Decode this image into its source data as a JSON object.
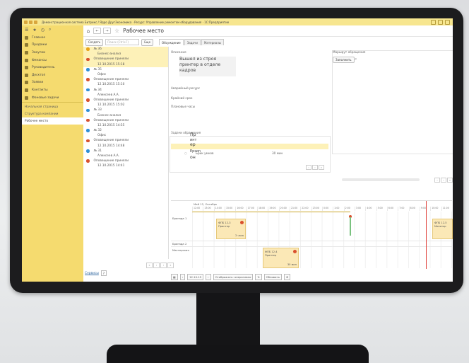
{
  "window": {
    "title": "Демонстрационная система Битрикс / Ядро ДругЭкономика · Ресурс: Управление ремонтом оборудования · 1С:Предприятие"
  },
  "sidebar": {
    "items": [
      {
        "label": "Главное",
        "icon": "home-icon"
      },
      {
        "label": "Продажи",
        "icon": "sales-icon"
      },
      {
        "label": "Закупки",
        "icon": "purchase-icon"
      },
      {
        "label": "Финансы",
        "icon": "finance-icon"
      },
      {
        "label": "Руководитель",
        "icon": "manager-icon"
      },
      {
        "label": "Десктоп",
        "icon": "desktop-icon"
      },
      {
        "label": "Заявки",
        "icon": "request-icon"
      },
      {
        "label": "Контакты",
        "icon": "contacts-icon"
      },
      {
        "label": "Фоновые задачи",
        "icon": "tasks-icon"
      }
    ],
    "links": [
      {
        "label": "Начальная страница",
        "active": false
      },
      {
        "label": "Структура компании",
        "active": false
      },
      {
        "label": "Рабочее место",
        "active": true
      }
    ]
  },
  "header": {
    "page_title": "Рабочее место",
    "back_label": "←",
    "forward_label": "→"
  },
  "controls": {
    "create_label": "Создать",
    "search_placeholder": "Поиск (Ctrl+F)",
    "more_label": "Еще",
    "tabs": [
      {
        "label": "Обсуждение",
        "active": true
      },
      {
        "label": "Задачи",
        "active": false
      },
      {
        "label": "Материалы",
        "active": false
      }
    ]
  },
  "list": {
    "rows": [
      {
        "text": "№ 36",
        "dot": "#e8a31b",
        "sel": true,
        "indent": false
      },
      {
        "text": "Бизнес-анализ",
        "dot": "",
        "sel": true,
        "indent": true
      },
      {
        "text": "Оповещение приняли",
        "dot": "#d9502e",
        "sel": true,
        "indent": false
      },
      {
        "text": "12.10.2015 15:18",
        "dot": "",
        "sel": true,
        "indent": true
      },
      {
        "text": "№ 35",
        "dot": "#2e8fd8",
        "sel": false,
        "indent": false
      },
      {
        "text": "Офис",
        "dot": "",
        "sel": false,
        "indent": true
      },
      {
        "text": "Оповещение приняли",
        "dot": "#d9502e",
        "sel": false,
        "indent": false
      },
      {
        "text": "12.10.2015 15:10",
        "dot": "",
        "sel": false,
        "indent": true
      },
      {
        "text": "№ 34",
        "dot": "#2e8fd8",
        "sel": false,
        "indent": false
      },
      {
        "text": "Алексеев А.А.",
        "dot": "",
        "sel": false,
        "indent": true
      },
      {
        "text": "Оповещение приняли",
        "dot": "#d9502e",
        "sel": false,
        "indent": false
      },
      {
        "text": "12.10.2015 15:02",
        "dot": "",
        "sel": false,
        "indent": true
      },
      {
        "text": "№ 33",
        "dot": "#2e8fd8",
        "sel": false,
        "indent": false
      },
      {
        "text": "Бизнес-анализ",
        "dot": "",
        "sel": false,
        "indent": true
      },
      {
        "text": "Оповещение приняли",
        "dot": "#d9502e",
        "sel": false,
        "indent": false
      },
      {
        "text": "12.10.2015 14:55",
        "dot": "",
        "sel": false,
        "indent": true
      },
      {
        "text": "№ 32",
        "dot": "#2e8fd8",
        "sel": false,
        "indent": false
      },
      {
        "text": "Офис",
        "dot": "",
        "sel": false,
        "indent": true
      },
      {
        "text": "Оповещение приняли",
        "dot": "#d9502e",
        "sel": false,
        "indent": false
      },
      {
        "text": "12.10.2015 14:48",
        "dot": "",
        "sel": false,
        "indent": true
      },
      {
        "text": "№ 31",
        "dot": "#2e8fd8",
        "sel": false,
        "indent": false
      },
      {
        "text": "Алексеев А.А.",
        "dot": "",
        "sel": false,
        "indent": true
      },
      {
        "text": "Оповещение приняли",
        "dot": "#d9502e",
        "sel": false,
        "indent": false
      },
      {
        "text": "12.10.2015 14:41",
        "dot": "",
        "sel": false,
        "indent": true
      }
    ],
    "footer_link": "Сервисы",
    "help_label": "?"
  },
  "detail": {
    "description_label": "Описание",
    "description_text_1": "Вышел из строя",
    "description_text_2": "принтер в отделе",
    "description_text_3": "кадров",
    "equipment_label": "Аварийный ресурс",
    "deadline_label": "Крайний срок",
    "planned_label": "Плановые часы",
    "tasks_label": "Задачи обращения",
    "task_name_1": "Пр",
    "task_name_2": "инт",
    "task_name_3": "ер",
    "task_row_1": "Epson",
    "task_row_2": "он",
    "task_assignee": "Брик умнов",
    "task_hours": "30 мин",
    "route_label": "Маршрут обращения",
    "route_button": "Заполнить"
  },
  "gantt": {
    "period_label": "Май 12, Октябрь",
    "hours": [
      "12:00",
      "13:00",
      "14:00",
      "15:00",
      "16:00",
      "17:00",
      "18:00",
      "19:00",
      "20:00",
      "21:00",
      "22:00",
      "23:00",
      "0:00",
      "1:00",
      "2:00",
      "3:00",
      "4:00",
      "5:00",
      "6:00",
      "7:00",
      "8:00",
      "9:00",
      "10:00",
      "11:00"
    ],
    "rows": [
      {
        "label": "Бригада 1"
      },
      {
        "label": "Бригада 2"
      },
      {
        "label": "Мастерская"
      }
    ],
    "cards": [
      {
        "title": "ФПБ 12-3",
        "sub": "Принтер",
        "time": "2 часа"
      },
      {
        "title": "ФПБ 12-4",
        "sub": "Принтер",
        "time": "30 мин"
      },
      {
        "title": "ФПБ 12-5",
        "sub": "Монитор",
        "time": ""
      }
    ]
  },
  "bottombar": {
    "date": "12.10.15",
    "stage_label": "Отображать: оперативно",
    "refresh_label": "Обновить"
  },
  "colors": {
    "sidebar": "#f5db6f",
    "selection": "#fdf1b8",
    "accent_red": "#d9502e",
    "accent_blue": "#2e8fd8"
  }
}
